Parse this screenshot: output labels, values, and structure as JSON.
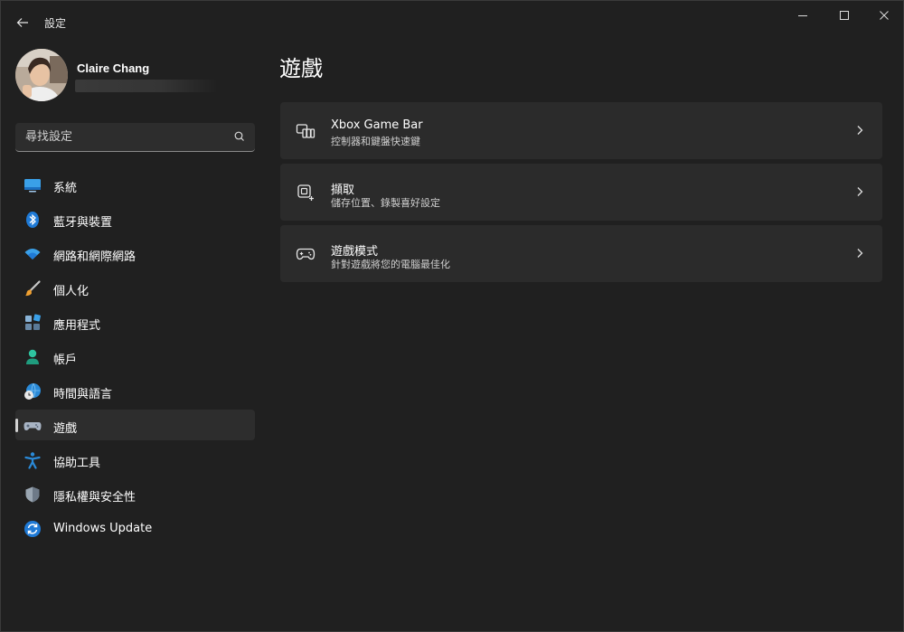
{
  "window": {
    "title": "設定"
  },
  "profile": {
    "name": "Claire Chang"
  },
  "search": {
    "placeholder": "尋找設定"
  },
  "nav": {
    "items": [
      {
        "label": "系統",
        "icon": "monitor-icon"
      },
      {
        "label": "藍牙與裝置",
        "icon": "bluetooth-icon"
      },
      {
        "label": "網路和網際網路",
        "icon": "wifi-icon"
      },
      {
        "label": "個人化",
        "icon": "brush-icon"
      },
      {
        "label": "應用程式",
        "icon": "apps-icon"
      },
      {
        "label": "帳戶",
        "icon": "person-icon"
      },
      {
        "label": "時間與語言",
        "icon": "globe-clock-icon"
      },
      {
        "label": "遊戲",
        "icon": "gamepad-icon",
        "selected": true
      },
      {
        "label": "協助工具",
        "icon": "accessibility-icon"
      },
      {
        "label": "隱私權與安全性",
        "icon": "shield-icon"
      },
      {
        "label": "Windows Update",
        "icon": "update-icon"
      }
    ]
  },
  "main": {
    "title": "遊戲",
    "cards": [
      {
        "title": "Xbox Game Bar",
        "subtitle": "控制器和鍵盤快速鍵",
        "icon": "game-bar-icon"
      },
      {
        "title": "擷取",
        "subtitle": "儲存位置、錄製喜好設定",
        "icon": "capture-icon"
      },
      {
        "title": "遊戲模式",
        "subtitle": "針對遊戲將您的電腦最佳化",
        "icon": "game-mode-icon"
      }
    ]
  },
  "colors": {
    "background": "#202020",
    "card": "#2b2b2b",
    "accent": "#0f8be0"
  }
}
